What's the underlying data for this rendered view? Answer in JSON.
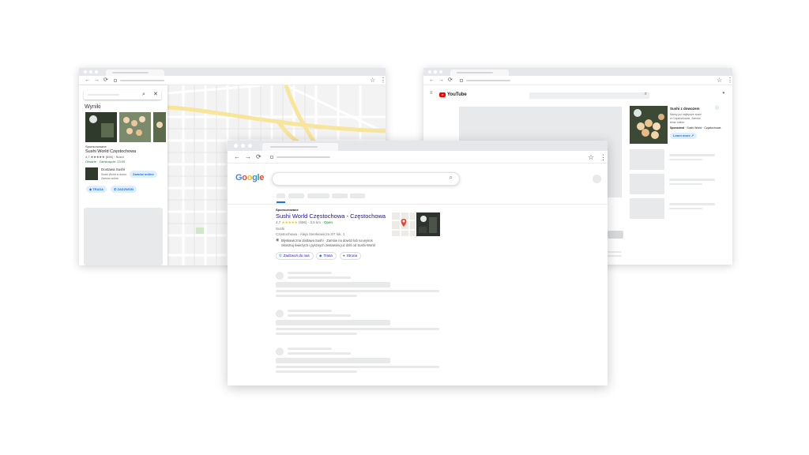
{
  "maps_window": {
    "results_heading": "Wyniki",
    "sponsored": "Sponsorowane",
    "business_name": "Sushi World Częstochowa",
    "rating_line": "4,7 ★★★★★ (696) · Sushi",
    "status_line": "Otwarte · Zamknięcie: 23:00",
    "secondary_title": "Dostawa Sushi",
    "secondary_line1": "Sushi World w domu.",
    "secondary_line2": "Zamów online.",
    "order_button": "Zamów online",
    "route_button": "TRASA",
    "call_button": "ZADZWOŃ"
  },
  "youtube_window": {
    "logo_text": "YouTube",
    "ad_title": "Sushi z dowozem",
    "ad_line1": "Mamy już najlepsze sushi",
    "ad_line2": "w Częstochowie. Zamów",
    "ad_line3": "teraz online.",
    "sponsor_label": "Sponsored",
    "sponsor_name": "Sushi World · Częstochowa",
    "learn_more": "Learn more"
  },
  "google_window": {
    "logo_letters": [
      {
        "ch": "G",
        "color": "#4285f4"
      },
      {
        "ch": "o",
        "color": "#ea4335"
      },
      {
        "ch": "o",
        "color": "#fbbc05"
      },
      {
        "ch": "g",
        "color": "#4285f4"
      },
      {
        "ch": "l",
        "color": "#34a853"
      },
      {
        "ch": "e",
        "color": "#ea4335"
      }
    ],
    "sponsored": "Sponsorowane",
    "result_title": "Sushi World Częstochowa - Częstochowa",
    "rating": "4,7",
    "stars": "★★★★★",
    "reviews": "(696)",
    "distance": "3,5 km",
    "open_status": "Open",
    "category": "Sushi",
    "address": "Częstochowa · Aleja Sienkiewicza 3/7 lok. 1",
    "desc_line1": "Błyskawiczna dostawa Sushi · Zamów na dowóz lub na wynos",
    "desc_line2": "Skosztuj świeżych i pysznych zestawów już dziś od Sushi World",
    "chip_call": "Zadzwoń do nas",
    "chip_route": "Trasa",
    "chip_site": "Strona",
    "colors": {
      "link": "#1a0dab",
      "accent": "#1a73e8",
      "star": "#fbbc04"
    }
  }
}
